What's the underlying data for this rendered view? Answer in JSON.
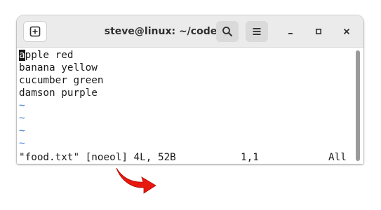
{
  "window": {
    "title": "steve@linux: ~/code"
  },
  "icons": {
    "new_tab": "new-tab-icon",
    "search": "search-icon",
    "menu": "hamburger-menu-icon",
    "minimize": "minimize-icon",
    "maximize": "maximize-icon",
    "close": "close-icon",
    "annotation": "curved-arrow-icon"
  },
  "editor": {
    "cursor_char": "a",
    "lines": [
      "pple red",
      "banana yellow",
      "cucumber green",
      "damson purple"
    ],
    "empty_line_marker": "~",
    "status": {
      "file_info": "\"food.txt\" [noeol] 4L, 52B",
      "position": "1,1",
      "scroll": "All"
    }
  },
  "colors": {
    "tilde": "#3f7fd0",
    "arrow": "#e8180f",
    "titlebar": "#ebebeb"
  }
}
